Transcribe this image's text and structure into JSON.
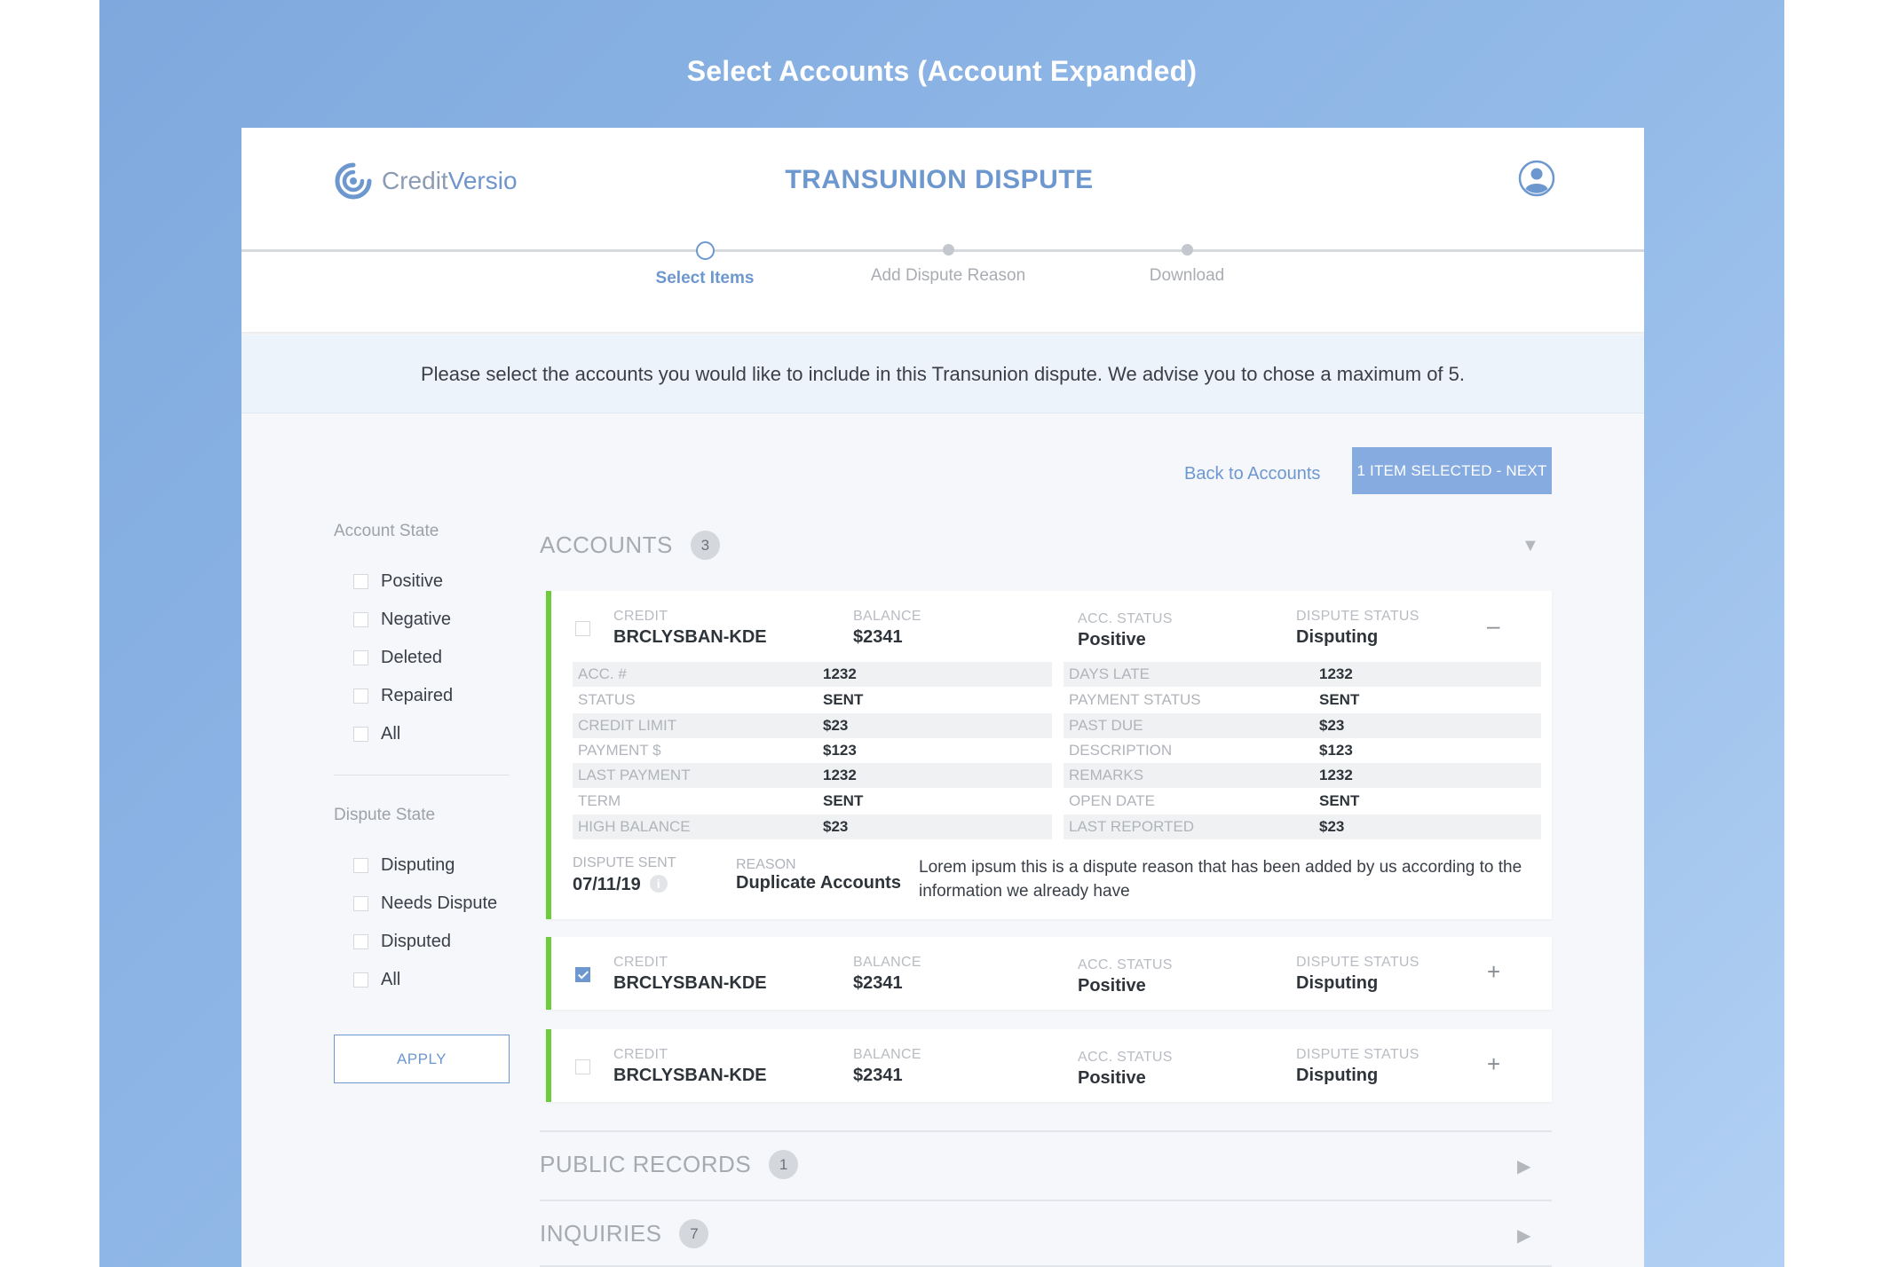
{
  "frame_title": "Select Accounts (Account Expanded)",
  "brand": {
    "name_part1": "Credit",
    "name_part2": "Versio",
    "accent_color": "#6d97cf"
  },
  "header": {
    "title": "TRANSUNION DISPUTE"
  },
  "steps": [
    {
      "label": "Select Items",
      "state": "active"
    },
    {
      "label": "Add Dispute Reason",
      "state": "pending"
    },
    {
      "label": "Download",
      "state": "pending"
    }
  ],
  "notice": "Please select the accounts you would like to include in this Transunion dispute. We advise you to chose a maximum of 5.",
  "actions": {
    "back": "Back to Accounts",
    "next": "1 ITEM SELECTED - NEXT"
  },
  "filters": {
    "account_state": {
      "title": "Account State",
      "options": [
        "Positive",
        "Negative",
        "Deleted",
        "Repaired",
        "All"
      ]
    },
    "dispute_state": {
      "title": "Dispute State",
      "options": [
        "Disputing",
        "Needs Dispute",
        "Disputed",
        "All"
      ]
    },
    "apply": "APPLY"
  },
  "sections": {
    "accounts": {
      "name": "ACCOUNTS",
      "count": "3"
    },
    "public_records": {
      "name": "PUBLIC RECORDS",
      "count": "1"
    },
    "inquiries": {
      "name": "INQUIRIES",
      "count": "7"
    }
  },
  "column_labels": {
    "type": "CREDIT",
    "balance": "BALANCE",
    "acc_status": "ACC. STATUS",
    "dispute_status": "DISPUTE STATUS"
  },
  "accounts": [
    {
      "name": "BRCLYSBAN-KDE",
      "balance": "$2341",
      "acc_status": "Positive",
      "dispute_status": "Disputing",
      "checked": false,
      "expanded": true,
      "toggle": "–"
    },
    {
      "name": "BRCLYSBAN-KDE",
      "balance": "$2341",
      "acc_status": "Positive",
      "dispute_status": "Disputing",
      "checked": true,
      "expanded": false,
      "toggle": "+"
    },
    {
      "name": "BRCLYSBAN-KDE",
      "balance": "$2341",
      "acc_status": "Positive",
      "dispute_status": "Disputing",
      "checked": false,
      "expanded": false,
      "toggle": "+"
    }
  ],
  "details_left": [
    {
      "label": "ACC. #",
      "value": "1232"
    },
    {
      "label": "STATUS",
      "value": "SENT"
    },
    {
      "label": "CREDIT LIMIT",
      "value": "$23"
    },
    {
      "label": "PAYMENT $",
      "value": "$123"
    },
    {
      "label": "LAST PAYMENT",
      "value": "1232"
    },
    {
      "label": "TERM",
      "value": "SENT"
    },
    {
      "label": "HIGH BALANCE",
      "value": "$23"
    }
  ],
  "details_right": [
    {
      "label": "DAYS LATE",
      "value": "1232"
    },
    {
      "label": "PAYMENT STATUS",
      "value": "SENT"
    },
    {
      "label": "PAST DUE",
      "value": "$23"
    },
    {
      "label": "DESCRIPTION",
      "value": "$123"
    },
    {
      "label": "REMARKS",
      "value": "1232"
    },
    {
      "label": "OPEN DATE",
      "value": "SENT"
    },
    {
      "label": "LAST REPORTED",
      "value": "$23"
    }
  ],
  "dispute_info": {
    "sent_label": "DISPUTE SENT",
    "sent_value": "07/11/19",
    "info_glyph": "i",
    "reason_label": "REASON",
    "reason_value": "Duplicate Accounts",
    "reason_text": "Lorem ipsum this is a dispute reason that has been added by us according to the information we already have"
  }
}
